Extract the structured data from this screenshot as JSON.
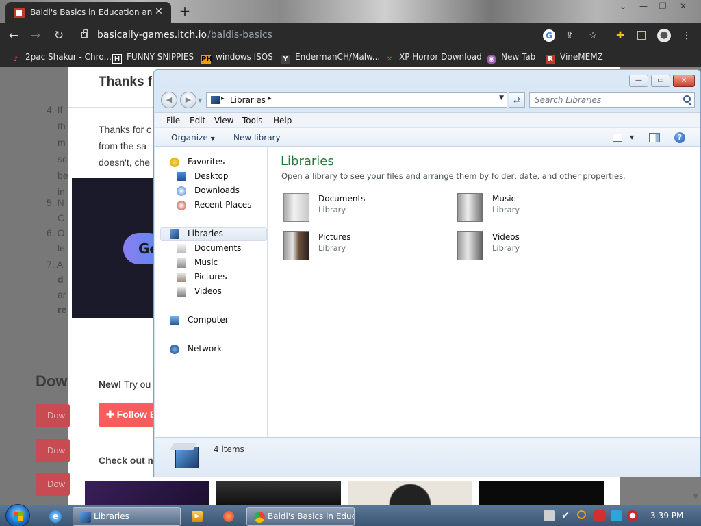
{
  "browser": {
    "tab_title": "Baldi's Basics in Education and L",
    "url_host": "basically-games.itch.io",
    "url_path": "/baldis-basics",
    "bookmarks": [
      {
        "label": "2pac Shakur - Chro...",
        "icon": "music-icon",
        "color": "#e74c3c"
      },
      {
        "label": "FUNNY SNIPPIES",
        "icon": "h-icon",
        "color": "#ffffff"
      },
      {
        "label": "windows ISOS",
        "icon": "ph-icon",
        "color": "#f39c12"
      },
      {
        "label": "EndermanCH/Malw...",
        "icon": "yp-icon",
        "color": "#555555"
      },
      {
        "label": "XP Horror Download",
        "icon": "x-icon",
        "color": "#e74c3c"
      },
      {
        "label": "New Tab",
        "icon": "globe-icon",
        "color": "#9b59b6"
      },
      {
        "label": "VineMEMZ",
        "icon": "r-icon",
        "color": "#c0392b"
      }
    ]
  },
  "webpage": {
    "heading": "Thanks fo",
    "list_items": [
      "4. If",
      "th",
      "m",
      "sc",
      "be",
      "in",
      "5. N",
      "C",
      "6. O",
      "le",
      "7. A",
      "d",
      "ar",
      "re"
    ],
    "para_lines": [
      "Thanks for c",
      "from the sa",
      "doesn't, che"
    ],
    "promo_button": "Ge",
    "downloads_heading": "Dow",
    "download_buttons": [
      "Dow",
      "Dow",
      "Dow"
    ],
    "new_label": "New!",
    "new_text": "Try ou",
    "follow_button": "Follow E",
    "check_out": "Check out m"
  },
  "explorer": {
    "address": "Libraries",
    "search_placeholder": "Search Libraries",
    "menu": [
      "File",
      "Edit",
      "View",
      "Tools",
      "Help"
    ],
    "organize": "Organize",
    "new_library": "New library",
    "nav": {
      "favorites": "Favorites",
      "desktop": "Desktop",
      "downloads": "Downloads",
      "recent": "Recent Places",
      "libraries": "Libraries",
      "lib_documents": "Documents",
      "lib_music": "Music",
      "lib_pictures": "Pictures",
      "lib_videos": "Videos",
      "computer": "Computer",
      "network": "Network"
    },
    "title": "Libraries",
    "description": "Open a library to see your files and arrange them by folder, date, and other properties.",
    "libraries": [
      {
        "name": "Documents",
        "type": "Library",
        "icon": "documents-library-icon"
      },
      {
        "name": "Music",
        "type": "Library",
        "icon": "music-library-icon"
      },
      {
        "name": "Pictures",
        "type": "Library",
        "icon": "pictures-library-icon"
      },
      {
        "name": "Videos",
        "type": "Library",
        "icon": "videos-library-icon"
      }
    ],
    "item_count": "4 items"
  },
  "taskbar": {
    "libraries_button": "Libraries",
    "chrome_button": "Baldi's Basics in Educ...",
    "clock": "3:39 PM"
  },
  "colors": {
    "library_title": "#1e7a33",
    "follow_button": "#fa5c5c",
    "chrome_dark": "#2a2a2a"
  }
}
